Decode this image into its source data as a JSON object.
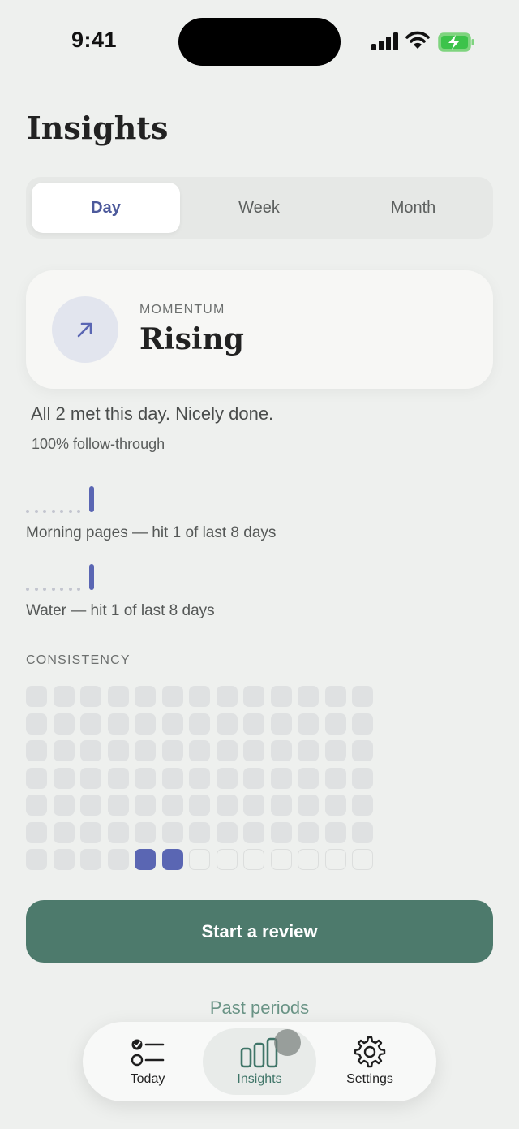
{
  "status_bar": {
    "time": "9:41"
  },
  "page": {
    "title": "Insights"
  },
  "segments": [
    {
      "label": "Day",
      "selected": true
    },
    {
      "label": "Week",
      "selected": false
    },
    {
      "label": "Month",
      "selected": false
    }
  ],
  "momentum": {
    "label": "MOMENTUM",
    "value": "Rising",
    "icon": "arrow-up-right-icon"
  },
  "summary": {
    "text": "All 2 met this day. Nicely done.",
    "follow_through": "100% follow-through"
  },
  "habits": [
    {
      "label": "Morning pages — hit 1 of last 8 days",
      "last_8_days": [
        0,
        0,
        0,
        0,
        0,
        0,
        0,
        1
      ]
    },
    {
      "label": "Water — hit 1 of last 8 days",
      "last_8_days": [
        0,
        0,
        0,
        0,
        0,
        0,
        0,
        1
      ]
    }
  ],
  "consistency": {
    "label": "CONSISTENCY",
    "columns": 13,
    "rows": 7,
    "hit_cells": [
      [
        6,
        4
      ],
      [
        6,
        5
      ]
    ],
    "future_cells_start": [
      6,
      6
    ]
  },
  "cta": {
    "label": "Start a review"
  },
  "past_periods": {
    "label": "Past periods"
  },
  "tabbar": [
    {
      "label": "Today",
      "icon": "checklist-icon",
      "active": false
    },
    {
      "label": "Insights",
      "icon": "bar-chart-icon",
      "active": true
    },
    {
      "label": "Settings",
      "icon": "gear-icon",
      "active": false
    }
  ],
  "colors": {
    "accent": "#5a66b3",
    "primary": "#4d7a6c",
    "background": "#eef0ee"
  }
}
